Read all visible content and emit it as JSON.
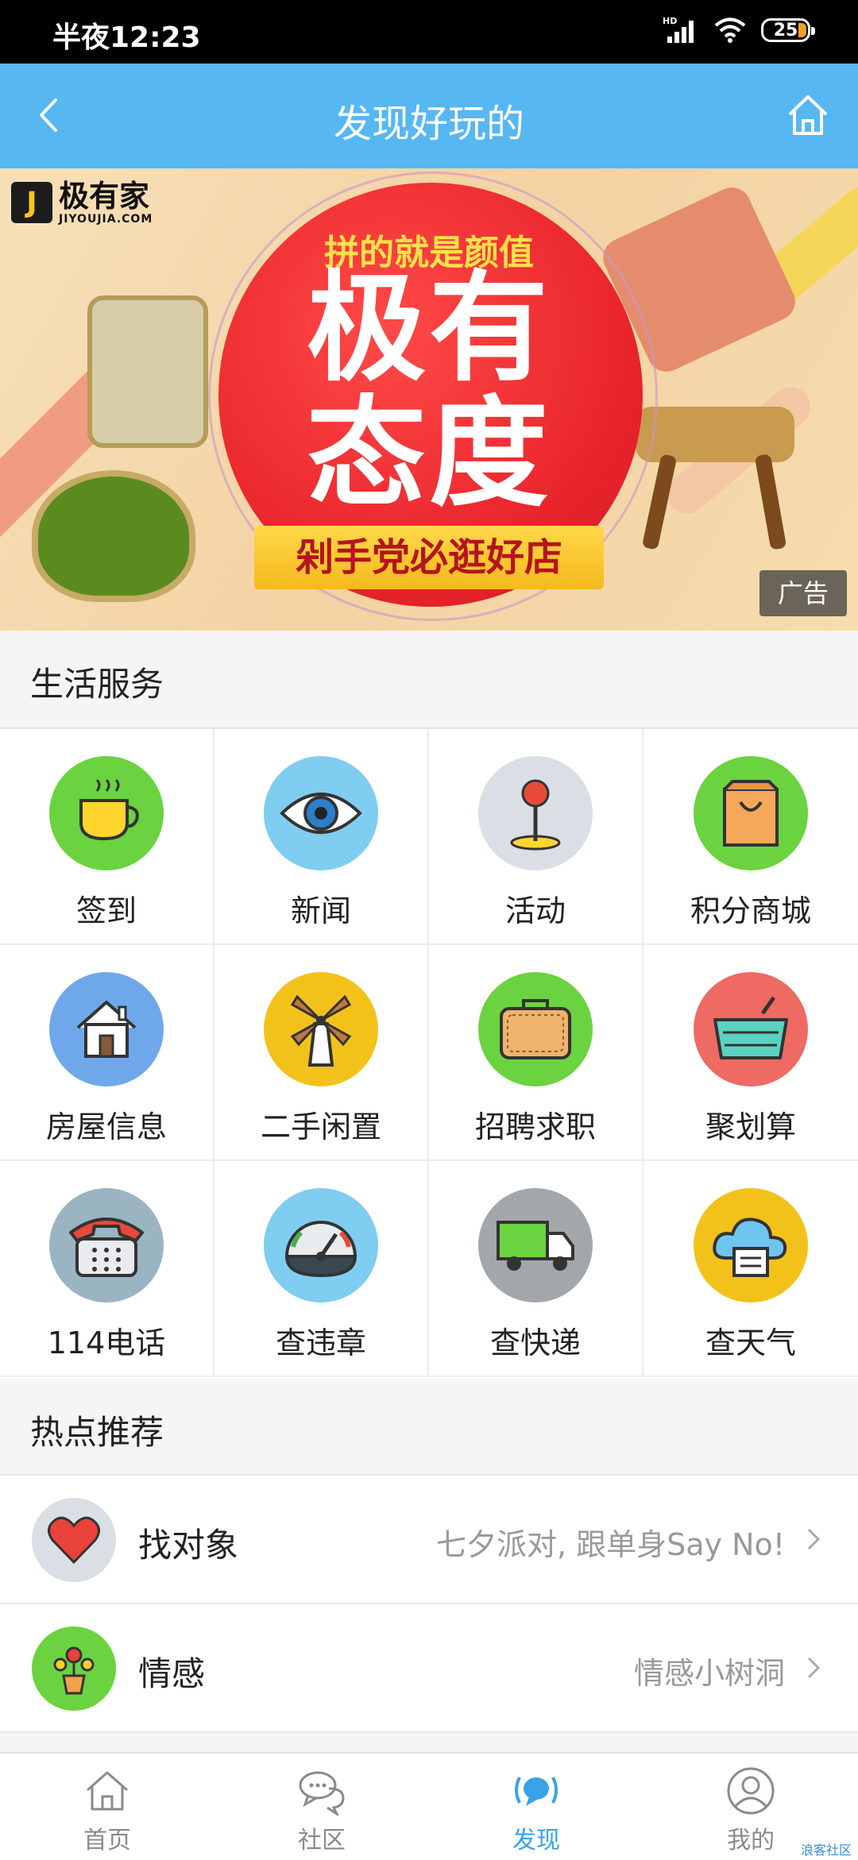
{
  "status_bar": {
    "time": "半夜12:23",
    "battery": "25",
    "network": "HD"
  },
  "header": {
    "title": "发现好玩的"
  },
  "banner": {
    "brand_name": "极有家",
    "brand_domain": "JIYOUJIA.COM",
    "slogan_top": "拼的就是颜值",
    "headline_line1": "极有",
    "headline_line2": "态度",
    "ribbon": "剁手党必逛好店",
    "ad_label": "广告"
  },
  "life_services": {
    "title": "生活服务",
    "items": [
      {
        "label": "签到",
        "icon": "coffee-cup-icon",
        "bg": "#6ad33f"
      },
      {
        "label": "新闻",
        "icon": "eye-icon",
        "bg": "#7fcdf0"
      },
      {
        "label": "活动",
        "icon": "map-pin-icon",
        "bg": "#d9dfe4"
      },
      {
        "label": "积分商城",
        "icon": "shopping-bag-icon",
        "bg": "#6ad33f"
      },
      {
        "label": "房屋信息",
        "icon": "house-icon",
        "bg": "#6fa8ea"
      },
      {
        "label": "二手闲置",
        "icon": "windmill-icon",
        "bg": "#f3c21a"
      },
      {
        "label": "招聘求职",
        "icon": "briefcase-icon",
        "bg": "#6ad33f"
      },
      {
        "label": "聚划算",
        "icon": "basket-icon",
        "bg": "#ee6a62"
      },
      {
        "label": "114电话",
        "icon": "telephone-icon",
        "bg": "#9ab4c2"
      },
      {
        "label": "查违章",
        "icon": "speedometer-icon",
        "bg": "#7fcdf0"
      },
      {
        "label": "查快递",
        "icon": "truck-icon",
        "bg": "#a1a7ab"
      },
      {
        "label": "查天气",
        "icon": "cloud-icon",
        "bg": "#f3c21a"
      }
    ]
  },
  "hot": {
    "title": "热点推荐",
    "items": [
      {
        "name": "找对象",
        "desc": "七夕派对, 跟单身Say No!",
        "icon": "heart-icon",
        "bg": "#d9dfe4"
      },
      {
        "name": "情感",
        "desc": "情感小树洞",
        "icon": "flower-pot-icon",
        "bg": "#6ad33f"
      }
    ]
  },
  "bottom_nav": {
    "items": [
      {
        "label": "首页",
        "icon": "home-icon"
      },
      {
        "label": "社区",
        "icon": "chat-icon"
      },
      {
        "label": "发现",
        "icon": "discover-icon",
        "active": true
      },
      {
        "label": "我的",
        "icon": "profile-icon"
      }
    ]
  },
  "watermark": "浪客社区"
}
